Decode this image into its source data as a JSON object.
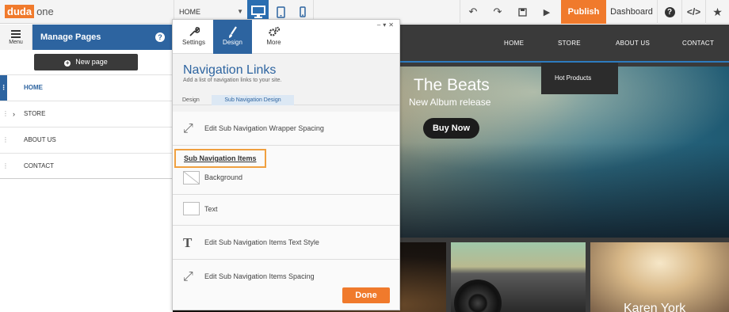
{
  "topbar": {
    "logo_part1": "duda",
    "logo_part2": "one",
    "page_select": "HOME",
    "publish": "Publish",
    "dashboard": "Dashboard"
  },
  "left_panel": {
    "menu_label": "Menu",
    "header_title": "Manage Pages",
    "help": "?",
    "new_page": "New page",
    "pages": [
      {
        "label": "HOME",
        "selected": true
      },
      {
        "label": "STORE",
        "has_children": true
      },
      {
        "label": "ABOUT US"
      },
      {
        "label": "CONTACT"
      }
    ]
  },
  "site": {
    "nav": [
      "HOME",
      "STORE",
      "ABOUT US",
      "CONTACT"
    ],
    "dropdown_item": "Hot Products",
    "hero_title": "The Beats",
    "hero_subtitle": "New Album release",
    "buy_button": "Buy Now",
    "tile_text": "Karen York"
  },
  "design_panel": {
    "tabs": [
      "Settings",
      "Design",
      "More"
    ],
    "active_tab": "Design",
    "title": "Navigation Links",
    "description": "Add a list of navigation links to your site.",
    "subtabs": [
      "Design",
      "Sub Navigation Design"
    ],
    "active_subtab": "Sub Navigation Design",
    "options": {
      "wrapper_spacing": "Edit Sub Navigation Wrapper Spacing",
      "section_heading": "Sub Navigation Items",
      "background": "Background",
      "text": "Text",
      "text_style": "Edit Sub Navigation Items Text Style",
      "items_spacing": "Edit Sub Navigation Items Spacing"
    },
    "done": "Done"
  },
  "colors": {
    "accent_orange": "#f07a2c",
    "brand_blue": "#2d64a0",
    "highlight_border": "#f0a040"
  }
}
